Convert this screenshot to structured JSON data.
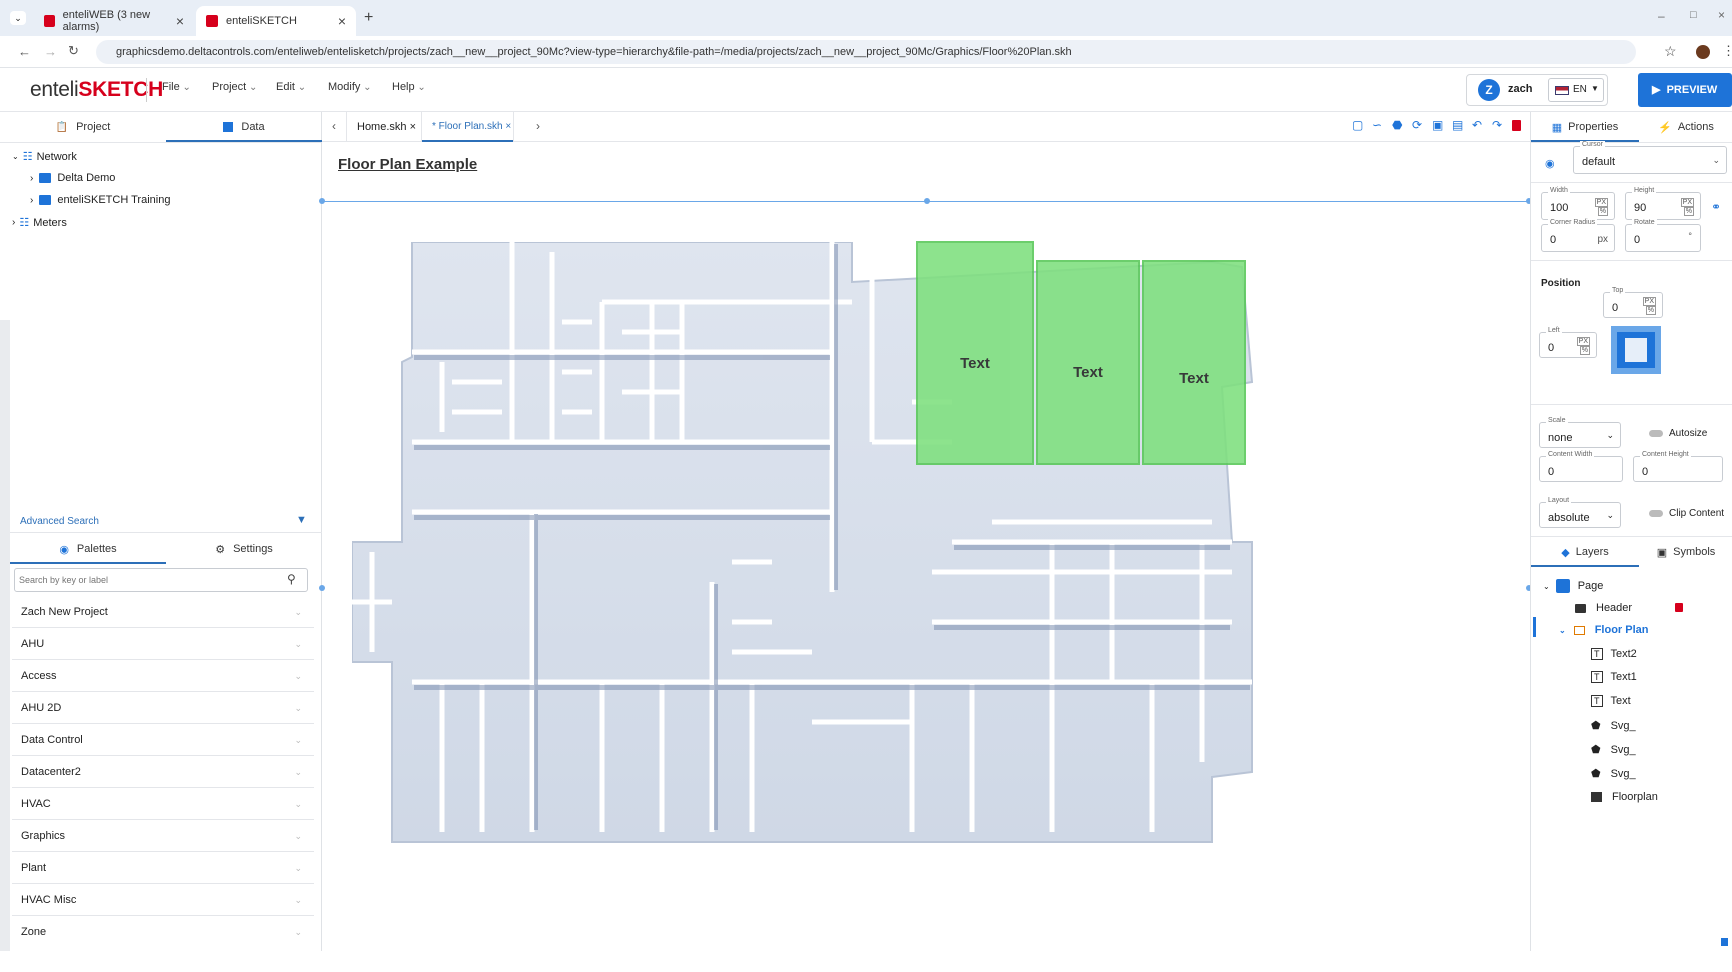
{
  "browser": {
    "tabs": [
      {
        "title": "enteliWEB (3 new alarms)"
      },
      {
        "title": "enteliSKETCH"
      }
    ],
    "url": "graphicsdemo.deltacontrols.com/enteliweb/entelisketch/projects/zach__new__project_90Mc?view-type=hierarchy&file-path=/media/projects/zach__new__project_90Mc/Graphics/Floor%20Plan.skh"
  },
  "app": {
    "logo_prefix": "enteli",
    "logo_suffix": "SKETCH",
    "menus": [
      "File",
      "Project",
      "Edit",
      "Modify",
      "Help"
    ],
    "user_initial": "Z",
    "user_name": "zach",
    "language": "EN",
    "preview_label": "PREVIEW",
    "brand_color": "#d6001c",
    "accent_color": "#1e73d8"
  },
  "left_panel": {
    "tabs": [
      "Project",
      "Data"
    ],
    "tree": [
      {
        "label": "Network",
        "expanded": true
      },
      {
        "label": "Delta Demo"
      },
      {
        "label": "enteliSKETCH Training"
      },
      {
        "label": "Meters"
      }
    ],
    "advanced_search": "Advanced Search",
    "bottom_tabs": [
      "Palettes",
      "Settings"
    ],
    "search_placeholder": "Search by key or label",
    "palettes": [
      "Zach New Project",
      "AHU",
      "Access",
      "AHU 2D",
      "Data Control",
      "Datacenter2",
      "HVAC",
      "Graphics",
      "Plant",
      "HVAC Misc",
      "Zone"
    ]
  },
  "editor": {
    "doc_tabs": [
      {
        "label": "Home.skh"
      },
      {
        "label": "* Floor Plan.skh",
        "active": true
      }
    ],
    "page_heading": "Floor Plan Example",
    "room_labels": [
      "Text",
      "Text",
      "Text"
    ],
    "highlight_color": "#7ee07e"
  },
  "right_panel": {
    "tabs": [
      "Properties",
      "Actions"
    ],
    "cursor_label": "Cursor",
    "cursor_value": "default",
    "width_label": "Width",
    "width_value": "100",
    "height_label": "Height",
    "height_value": "90",
    "corner_radius_label": "Corner Radius",
    "corner_radius_value": "0",
    "corner_radius_unit": "px",
    "rotate_label": "Rotate",
    "rotate_value": "0",
    "position_heading": "Position",
    "top_label": "Top",
    "top_value": "0",
    "left_label": "Left",
    "left_value": "0",
    "px_unit": "PX",
    "pct_unit": "%",
    "scale_label": "Scale",
    "scale_value": "none",
    "autosize_label": "Autosize",
    "content_width_label": "Content Width",
    "content_width_value": "0",
    "content_height_label": "Content Height",
    "content_height_value": "0",
    "layout_label": "Layout",
    "layout_value": "absolute",
    "clip_content_label": "Clip Content",
    "layer_tabs": [
      "Layers",
      "Symbols"
    ],
    "layers": [
      {
        "label": "Page",
        "icon": "page-icon"
      },
      {
        "label": "Header",
        "icon": "folder-icon",
        "locked": true
      },
      {
        "label": "Floor Plan",
        "icon": "folder-open-icon",
        "selected": true
      },
      {
        "label": "Text2",
        "icon": "text-icon"
      },
      {
        "label": "Text1",
        "icon": "text-icon"
      },
      {
        "label": "Text",
        "icon": "text-icon"
      },
      {
        "label": "Svg_",
        "icon": "shape-icon"
      },
      {
        "label": "Svg_",
        "icon": "shape-icon"
      },
      {
        "label": "Svg_",
        "icon": "shape-icon"
      },
      {
        "label": "Floorplan",
        "icon": "image-icon"
      }
    ]
  }
}
